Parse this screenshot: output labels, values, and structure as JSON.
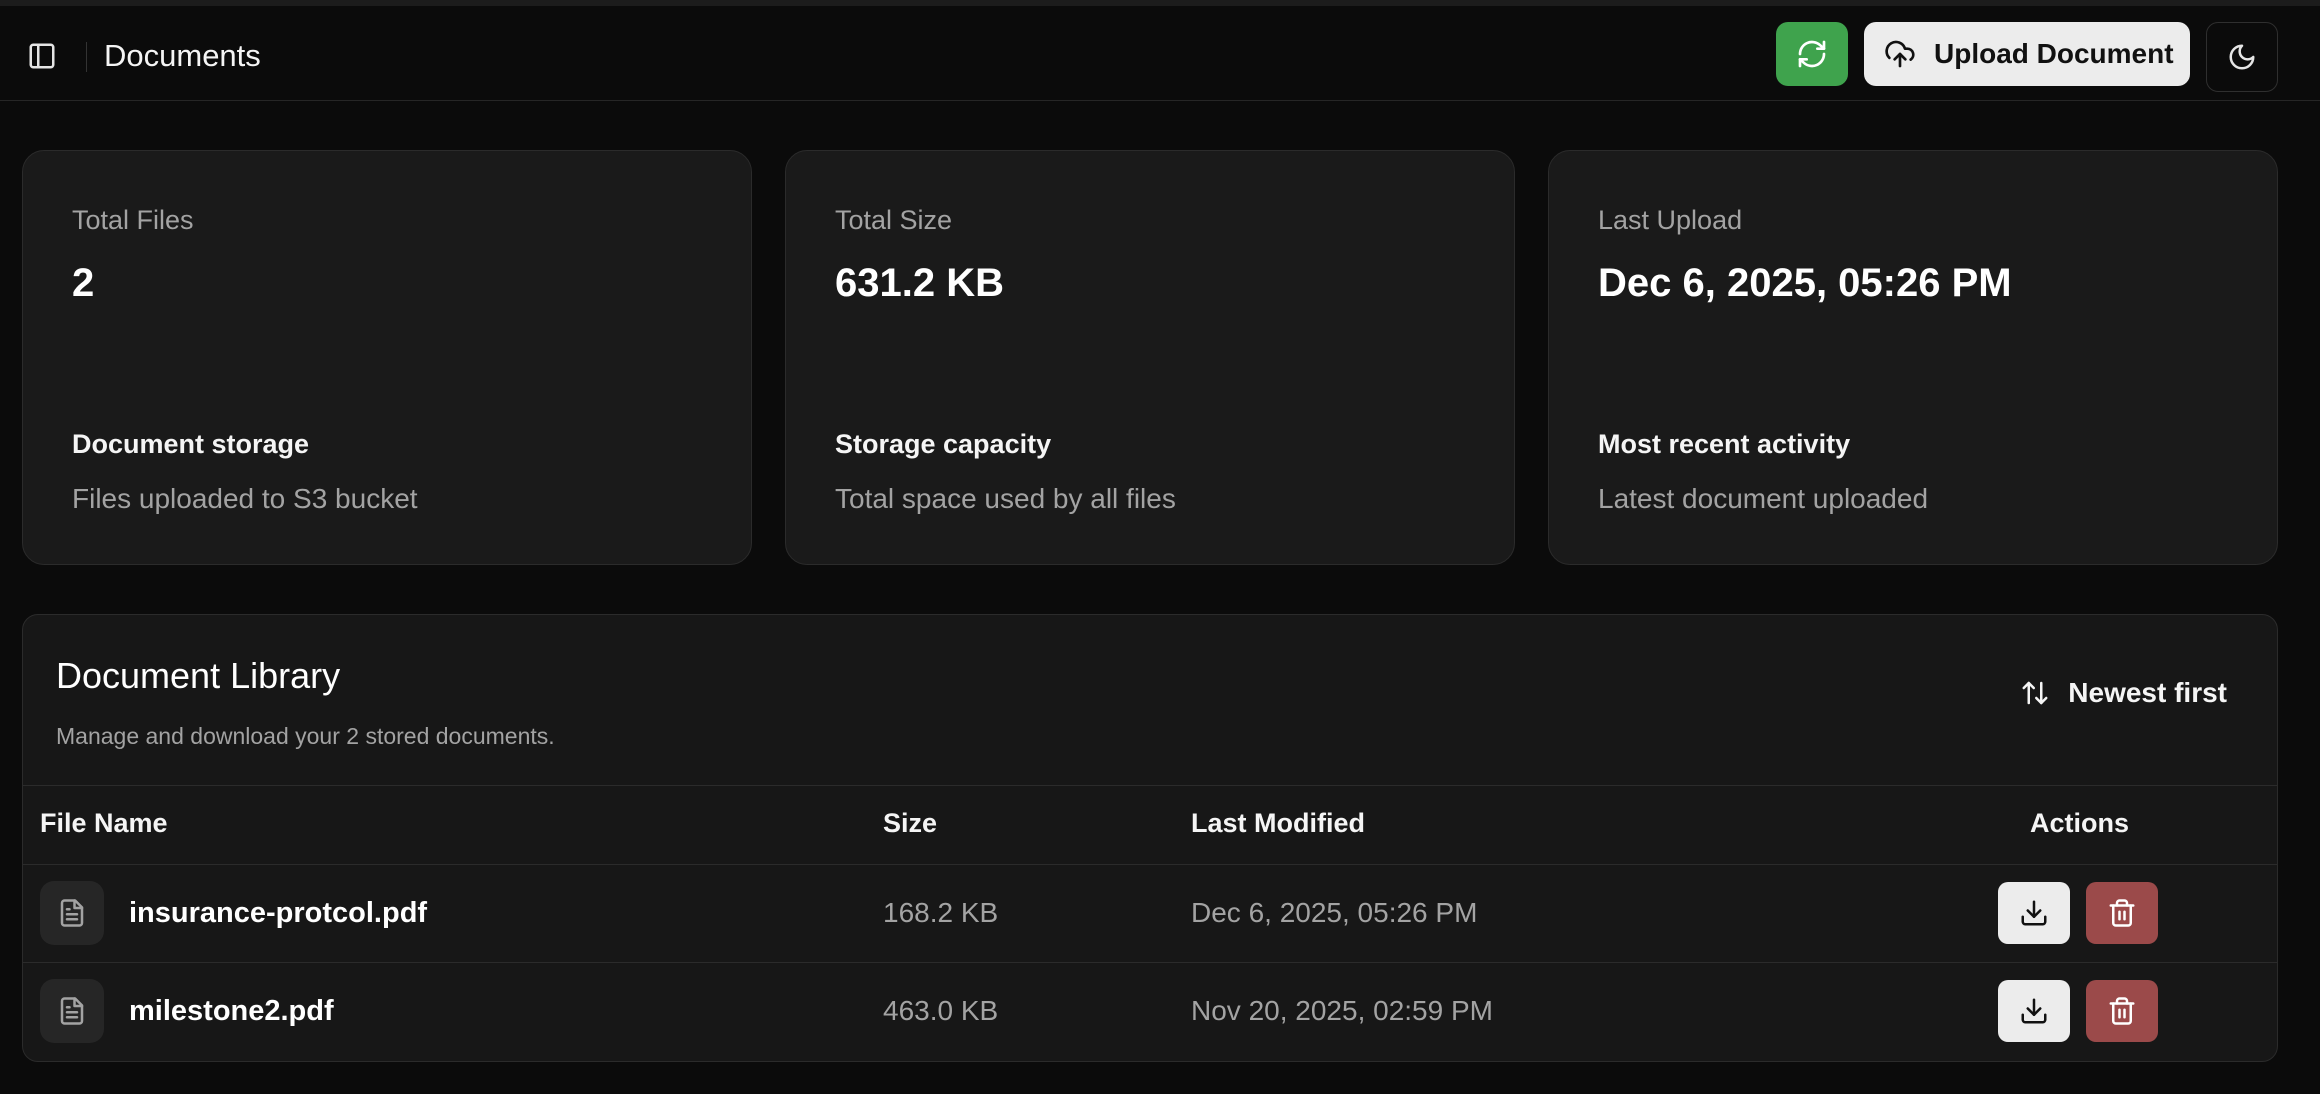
{
  "header": {
    "title": "Documents",
    "upload_label": "Upload Document",
    "icons": {
      "sidebar": "sidebar-toggle-icon",
      "refresh": "refresh-icon",
      "upload": "cloud-upload-icon",
      "theme": "moon-icon"
    },
    "colors": {
      "refresh_bg": "#3fa34d",
      "upload_bg": "#ececec"
    }
  },
  "stats": [
    {
      "label": "Total Files",
      "value": "2",
      "sub_title": "Document storage",
      "sub_desc": "Files uploaded to S3 bucket"
    },
    {
      "label": "Total Size",
      "value": "631.2 KB",
      "sub_title": "Storage capacity",
      "sub_desc": "Total space used by all files"
    },
    {
      "label": "Last Upload",
      "value": "Dec 6, 2025, 05:26 PM",
      "sub_title": "Most recent activity",
      "sub_desc": "Latest document uploaded"
    }
  ],
  "library": {
    "title": "Document Library",
    "description": "Manage and download your 2 stored documents.",
    "sort_label": "Newest first",
    "columns": [
      "File Name",
      "Size",
      "Last Modified",
      "Actions"
    ],
    "rows": [
      {
        "name": "insurance-protcol.pdf",
        "size": "168.2 KB",
        "modified": "Dec 6, 2025, 05:26 PM"
      },
      {
        "name": "milestone2.pdf",
        "size": "463.0 KB",
        "modified": "Nov 20, 2025, 02:59 PM"
      }
    ],
    "colors": {
      "delete_bg": "#9b4a4a",
      "download_bg": "#ececec"
    }
  }
}
